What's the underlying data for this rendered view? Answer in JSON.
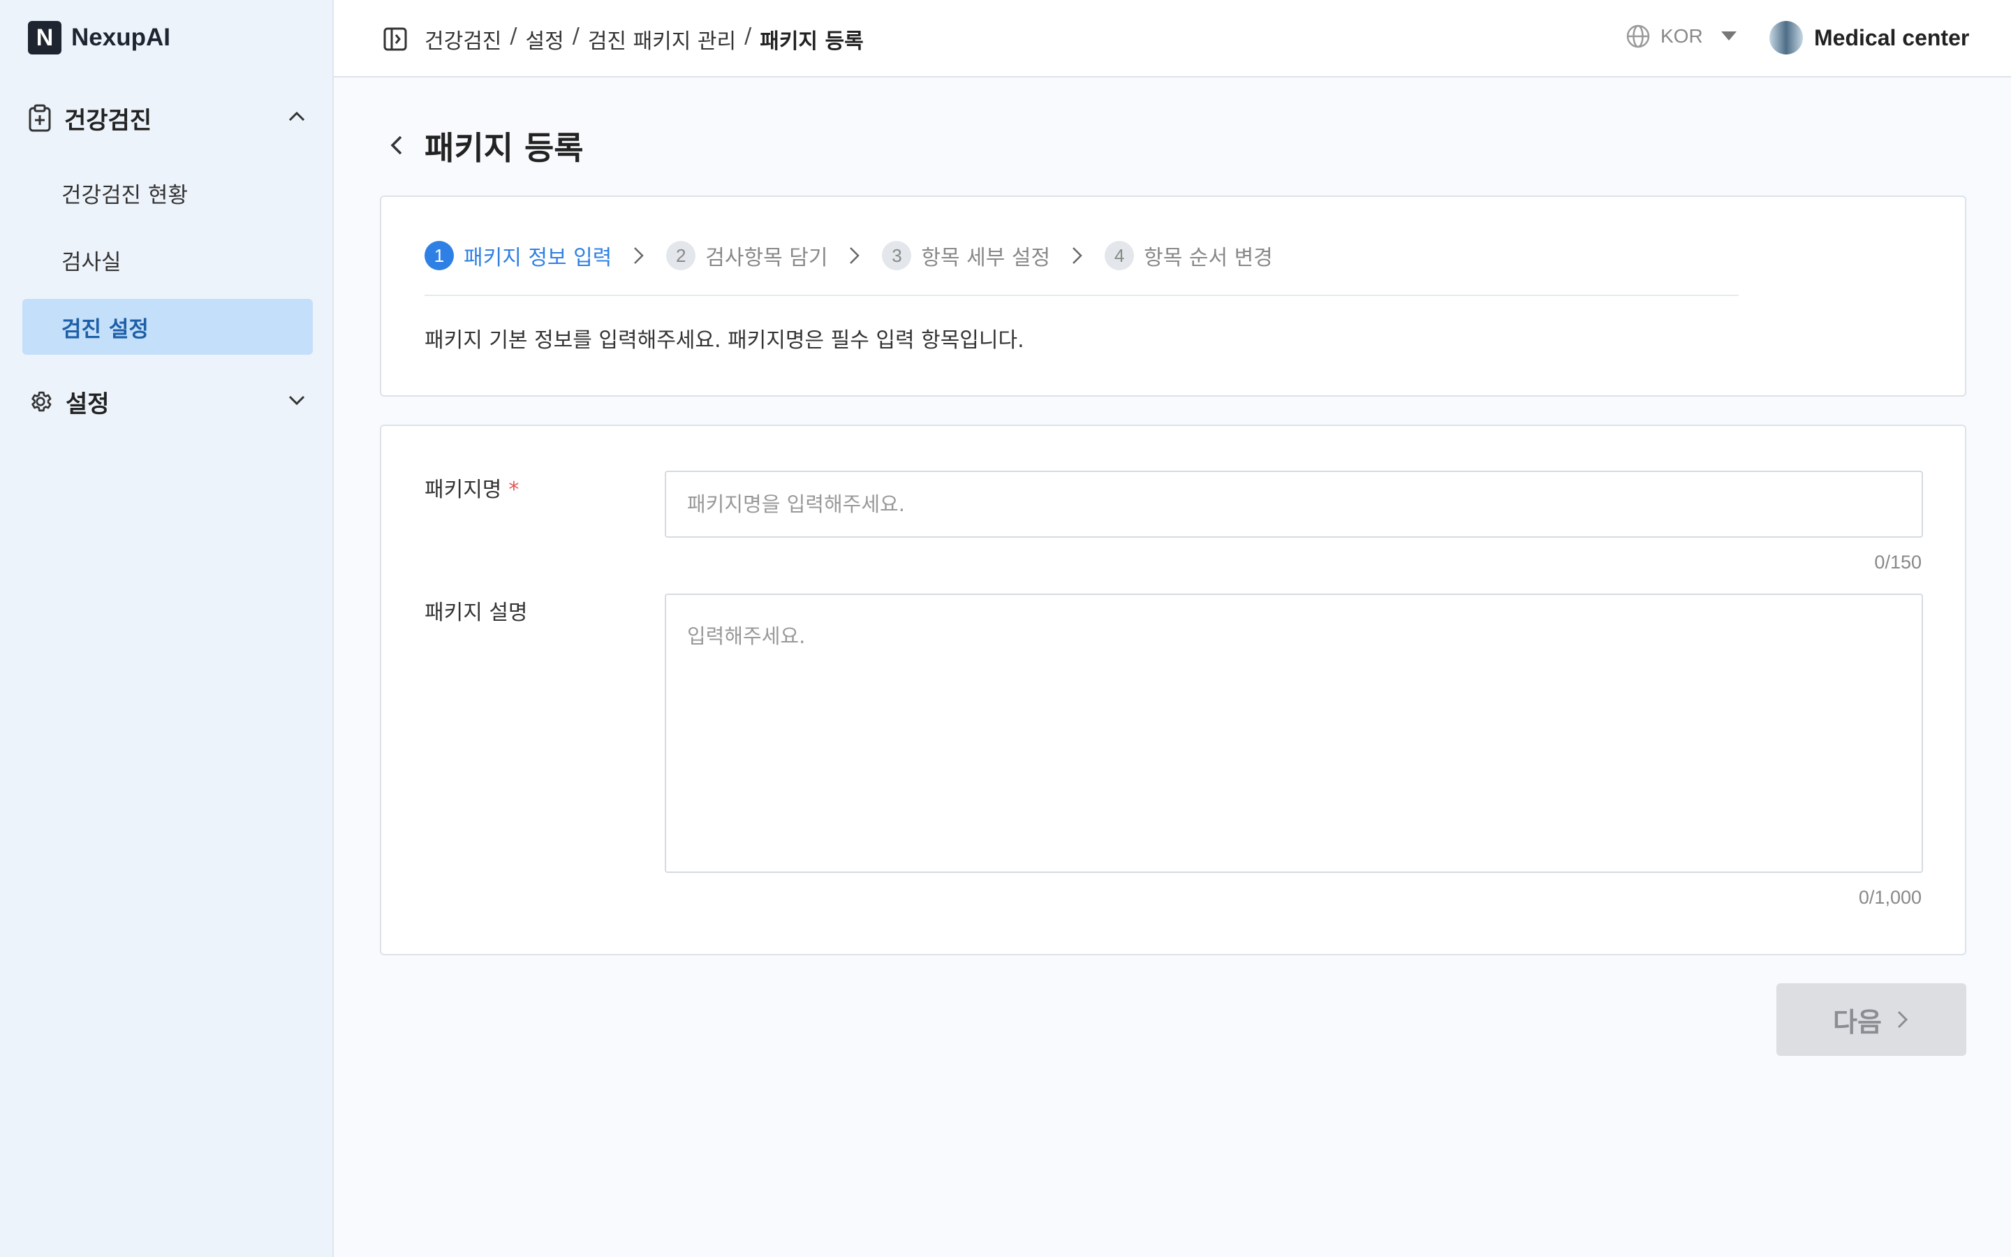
{
  "brand": {
    "logo_letter": "N",
    "name": "NexupAI"
  },
  "sidebar": {
    "groups": [
      {
        "label": "건강검진",
        "icon": "clipboard-plus-icon",
        "expanded": true,
        "items": [
          {
            "label": "건강검진 현황",
            "active": false
          },
          {
            "label": "검사실",
            "active": false
          },
          {
            "label": "검진 설정",
            "active": true
          }
        ]
      },
      {
        "label": "설정",
        "icon": "gear-icon",
        "expanded": false,
        "items": []
      }
    ]
  },
  "header": {
    "breadcrumb": [
      "건강검진",
      "설정",
      "검진 패키지 관리",
      "패키지 등록"
    ],
    "breadcrumb_separator": "/",
    "language": "KOR",
    "user_name": "Medical center"
  },
  "page": {
    "title": "패키지 등록"
  },
  "steps": {
    "items": [
      {
        "num": "1",
        "label": "패키지 정보 입력",
        "active": true
      },
      {
        "num": "2",
        "label": "검사항목 담기",
        "active": false
      },
      {
        "num": "3",
        "label": "항목 세부 설정",
        "active": false
      },
      {
        "num": "4",
        "label": "항목 순서 변경",
        "active": false
      }
    ],
    "description": "패키지 기본 정보를 입력해주세요. 패키지명은 필수 입력 항목입니다."
  },
  "form": {
    "name_label": "패키지명",
    "required_mark": "*",
    "name_value": "",
    "name_placeholder": "패키지명을 입력해주세요.",
    "name_counter": "0/150",
    "desc_label": "패키지 설명",
    "desc_value": "",
    "desc_placeholder": "입력해주세요.",
    "desc_counter": "0/1,000"
  },
  "actions": {
    "next_label": "다음"
  },
  "colors": {
    "accent": "#2f80e4",
    "active_nav_bg": "#c3dff9",
    "required": "#e85454",
    "disabled_btn": "#dcdee2"
  }
}
